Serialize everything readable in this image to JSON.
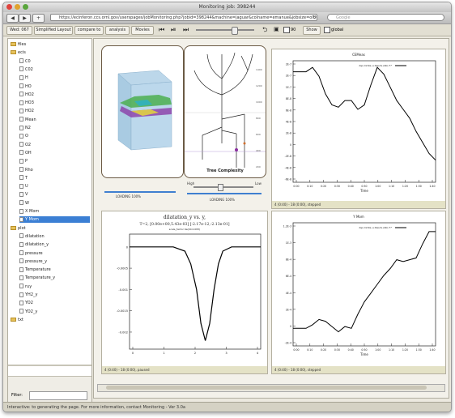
{
  "window": {
    "title": "Monitoring job: 398244"
  },
  "browser": {
    "url": "https://ecinferon.ccs.ornl.gov/userspages/jobMonitoring.php?jobid=398244&machine=jaguar&colname=emanue&jobsize=old",
    "search_placeholder": "Google"
  },
  "toolbar": {
    "job_label": "Wed: 067",
    "simplified_layout": "Simplified Layout",
    "compare_to": "compare to",
    "analysis": "analysis",
    "movies": "Movies",
    "show_label": "Show",
    "global_label": "global",
    "refresh_count": "90"
  },
  "sidebar": {
    "items": [
      {
        "label": "files",
        "kind": "folder",
        "level": 0
      },
      {
        "label": "ecis",
        "kind": "folder",
        "level": 0
      },
      {
        "label": "C0",
        "kind": "doc",
        "level": 1
      },
      {
        "label": "C02",
        "kind": "doc",
        "level": 1
      },
      {
        "label": "H",
        "kind": "doc",
        "level": 1
      },
      {
        "label": "HO",
        "kind": "doc",
        "level": 1
      },
      {
        "label": "HO2",
        "kind": "doc",
        "level": 1
      },
      {
        "label": "HO3",
        "kind": "doc",
        "level": 1
      },
      {
        "label": "HO2",
        "kind": "doc",
        "level": 1
      },
      {
        "label": "Mean",
        "kind": "doc",
        "level": 1
      },
      {
        "label": "N2",
        "kind": "doc",
        "level": 1
      },
      {
        "label": "O",
        "kind": "doc",
        "level": 1
      },
      {
        "label": "O2",
        "kind": "doc",
        "level": 1
      },
      {
        "label": "OH",
        "kind": "doc",
        "level": 1
      },
      {
        "label": "P",
        "kind": "doc",
        "level": 1
      },
      {
        "label": "Rho",
        "kind": "doc",
        "level": 1
      },
      {
        "label": "T",
        "kind": "doc",
        "level": 1
      },
      {
        "label": "U",
        "kind": "doc",
        "level": 1
      },
      {
        "label": "V",
        "kind": "doc",
        "level": 1
      },
      {
        "label": "W",
        "kind": "doc",
        "level": 1
      },
      {
        "label": "X Mom",
        "kind": "doc",
        "level": 1
      },
      {
        "label": "Y Mom",
        "kind": "doc",
        "level": 1,
        "selected": true
      },
      {
        "label": "plot",
        "kind": "folder",
        "level": 0
      },
      {
        "label": "dilatation",
        "kind": "doc",
        "level": 1
      },
      {
        "label": "dilatation_y",
        "kind": "doc",
        "level": 1
      },
      {
        "label": "pressure",
        "kind": "doc",
        "level": 1
      },
      {
        "label": "pressure_y",
        "kind": "doc",
        "level": 1
      },
      {
        "label": "Temperature",
        "kind": "doc",
        "level": 1
      },
      {
        "label": "Temperature_y",
        "kind": "doc",
        "level": 1
      },
      {
        "label": "ruy",
        "kind": "doc",
        "level": 1
      },
      {
        "label": "YH2_y",
        "kind": "doc",
        "level": 1
      },
      {
        "label": "YO2",
        "kind": "doc",
        "level": 1
      },
      {
        "label": "YO2_y",
        "kind": "doc",
        "level": 1
      },
      {
        "label": "txt",
        "kind": "folder",
        "level": 0
      }
    ],
    "filter_label": "Filter:"
  },
  "panels": {
    "tree": {
      "title": "Tree Complexity",
      "high": "High",
      "low": "Low",
      "loading1": "LOADING 100%",
      "loading2": "LOADING 100%",
      "axis": [
        "1400",
        "1200",
        "1000",
        "800",
        "600",
        "400",
        "200"
      ]
    },
    "chart_tr": {
      "title": "CEMeas",
      "legend": "dsp.m2(0e..e.tiles.fe.ahb),T:*",
      "foot": "4 (0:40) - 18 (0:00), stepped"
    },
    "chart_bl": {
      "title_line1": "dilatation_y vs. y,",
      "title_line2": "T=2, [0.00e+00,5.43e-03] [-2.17e-12,-2.13e-01]",
      "title_line3": "scale_factor 0e(00.0.083)",
      "foot": "4 (0:40) - 18 (0:00), paused"
    },
    "chart_br": {
      "title": "Y Mom",
      "legend": "dsp.m2(0e..e.tiles.fe.ahb),T:*",
      "foot": "4 (0:40) - 18 (0:00), stepped"
    }
  },
  "status": {
    "text": "Interactive: to generating the page. For more information, contact Monitoring - Ver 3.0a"
  },
  "chart_data": [
    {
      "type": "line",
      "title": "CEMeas",
      "x": [
        0,
        1,
        2,
        3,
        4,
        5,
        6,
        7,
        8,
        9,
        10,
        11,
        12,
        13,
        14,
        15,
        16,
        17,
        18,
        19,
        20,
        21,
        22
      ],
      "series": [
        {
          "name": "dsp.m2(0e..e.tiles.fe.ahb),T:*",
          "values": [
            5.0,
            5.0,
            5.0,
            5.2,
            4.8,
            4.0,
            3.5,
            3.4,
            3.7,
            3.7,
            3.3,
            3.5,
            4.4,
            5.2,
            4.9,
            4.3,
            3.7,
            3.3,
            2.9,
            2.3,
            1.8,
            1.3,
            1.0
          ]
        }
      ],
      "xlabel": "Time",
      "ylim": [
        0,
        5.5
      ],
      "y_ticks": [
        "2E-7",
        "2E-7",
        "1E-7",
        "8E-8",
        "6E-8",
        "4E-8",
        "2E-8",
        "0",
        "-2E-8",
        "-4E-8",
        "-6E-8"
      ],
      "x_ticks": [
        "0:00",
        "0:10",
        "0:20",
        "0:30",
        "0:40",
        "0:50",
        "1:00",
        "1:10",
        "1:20",
        "1:30",
        "1:40"
      ]
    },
    {
      "type": "line",
      "title": "dilatation_y vs. y,",
      "x": [
        0,
        0.5,
        1,
        1.5,
        1.9,
        2.1,
        2.3,
        2.45,
        2.6,
        2.75,
        2.9,
        3.05,
        3.2,
        3.5,
        4,
        4.5
      ],
      "series": [
        {
          "name": "dilatation_y",
          "values": [
            0,
            0,
            0,
            0,
            -0.0001,
            -0.0004,
            -0.001,
            -0.0018,
            -0.0022,
            -0.0018,
            -0.001,
            -0.0004,
            -0.0001,
            0,
            0,
            0
          ]
        }
      ],
      "xlim": [
        0,
        4.5
      ],
      "ylim": [
        -0.0024,
        0.0003
      ],
      "y_ticks": [
        "0",
        "-0.0005",
        "-0.001",
        "-0.0015",
        "-0.002"
      ],
      "x_ticks": [
        "0",
        "1",
        "2",
        "3",
        "4"
      ]
    },
    {
      "type": "line",
      "title": "Y Mom",
      "x": [
        0,
        1,
        2,
        3,
        4,
        5,
        6,
        7,
        8,
        9,
        10,
        11,
        12,
        13,
        14,
        15,
        16,
        17,
        18,
        19,
        20,
        21,
        22
      ],
      "series": [
        {
          "name": "dsp.m2(0e..e.tiles.fe.ahb),T:*",
          "values": [
            0,
            0,
            0,
            0.2,
            0.5,
            0.4,
            0.1,
            -0.2,
            0.1,
            0,
            0.8,
            1.5,
            2.0,
            2.5,
            3.0,
            3.4,
            3.9,
            3.8,
            3.9,
            4.0,
            4.8,
            5.5,
            5.5
          ]
        }
      ],
      "xlabel": "Time",
      "ylim": [
        -1,
        6
      ],
      "y_ticks": [
        "1.2E-3",
        "1E-3",
        "8E-4",
        "6E-4",
        "4E-4",
        "2E-4",
        "0",
        "-2E-4"
      ],
      "x_ticks": [
        "0:00",
        "0:10",
        "0:20",
        "0:30",
        "0:40",
        "0:50",
        "1:00",
        "1:10",
        "1:20",
        "1:30",
        "1:40"
      ]
    }
  ]
}
